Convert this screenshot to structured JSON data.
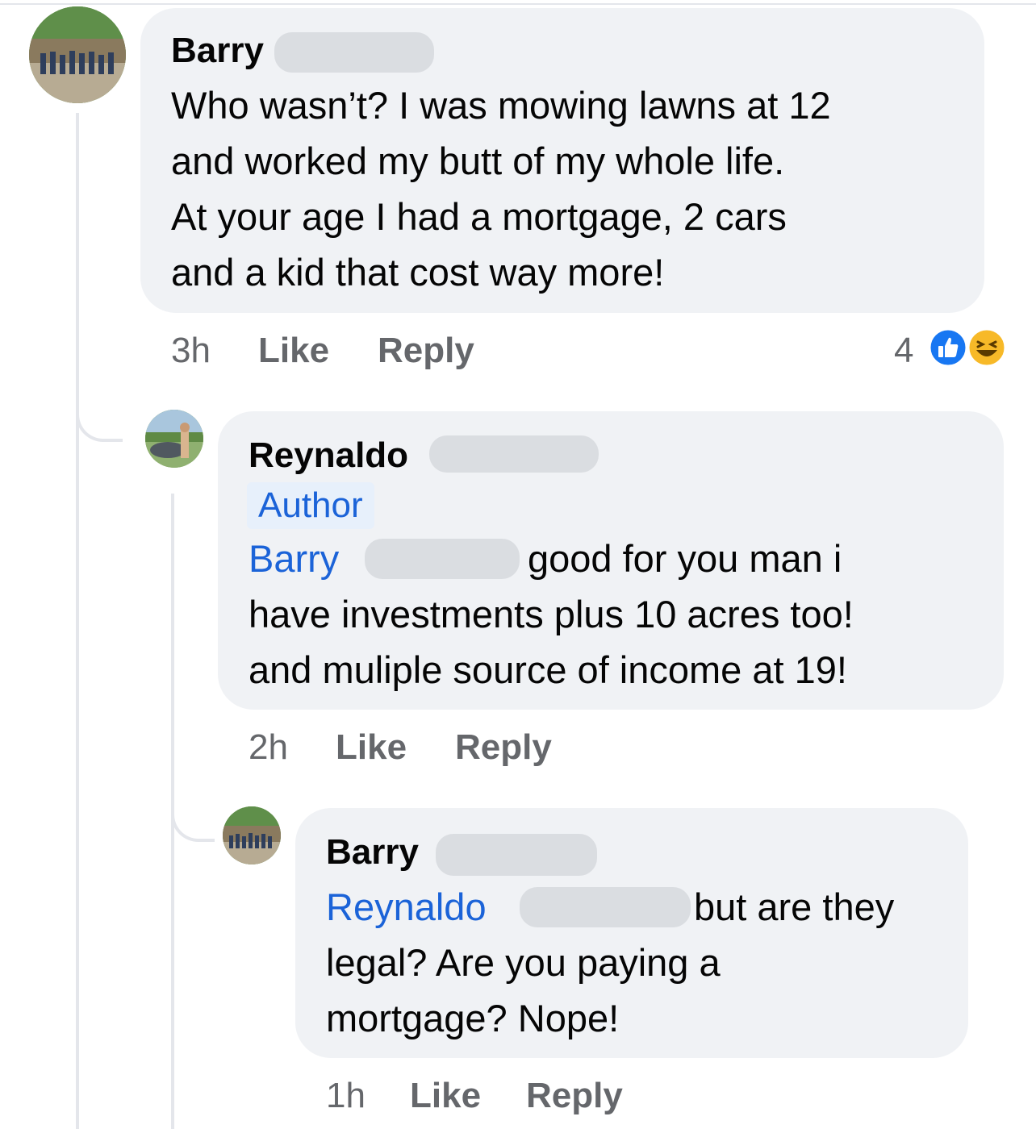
{
  "comments": [
    {
      "author": "Barry",
      "lines": [
        "Who wasn’t? I was mowing lawns at 12",
        "and worked my butt of my whole life.",
        "At your age I had a mortgage, 2 cars",
        "and a kid that cost way more!"
      ],
      "time": "3h",
      "like": "Like",
      "reply": "Reply",
      "reactions": {
        "count": "4",
        "icons": [
          "like-icon",
          "haha-icon"
        ],
        "like_color": "#1877f2",
        "haha_color": "#f7b928"
      }
    },
    {
      "author": "Reynaldo",
      "badge": "Author",
      "mention": "Barry",
      "lines": [
        "good for you man i",
        "have investments plus 10 acres too!",
        "and muliple source of income at 19!"
      ],
      "time": "2h",
      "like": "Like",
      "reply": "Reply"
    },
    {
      "author": "Barry",
      "mention": "Reynaldo",
      "lines": [
        "but are they",
        "legal?  Are you paying a",
        "mortgage? Nope!"
      ],
      "time": "1h",
      "like": "Like",
      "reply": "Reply"
    }
  ],
  "colors": {
    "bubble": "#f0f2f5",
    "link": "#1b63d8",
    "meta": "#65676b"
  }
}
